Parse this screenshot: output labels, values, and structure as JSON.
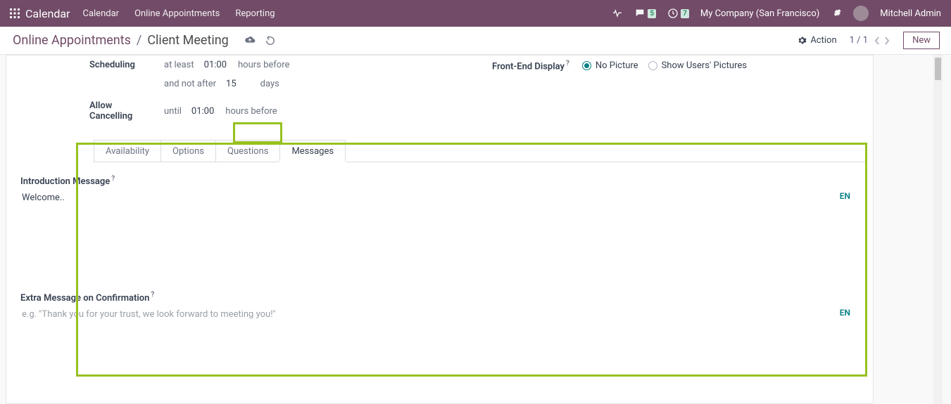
{
  "nav": {
    "brand": "Calendar",
    "menus": [
      "Calendar",
      "Online Appointments",
      "Reporting"
    ],
    "company": "My Company (San Francisco)",
    "user": "Mitchell Admin",
    "badge_chat": "5",
    "badge_clock": "7"
  },
  "cp": {
    "breadcrumb_parent": "Online Appointments",
    "breadcrumb_current": "Client Meeting",
    "action_label": "Action",
    "pager": "1 / 1",
    "new_label": "New"
  },
  "form": {
    "scheduling_label": "Scheduling",
    "at_least": "at least",
    "at_least_val": "01:00",
    "hours_before": "hours before",
    "and_not_after": "and not after",
    "not_after_val": "15",
    "days": "days",
    "allow_cancel_label": "Allow Cancelling",
    "until": "until",
    "until_val": "01:00",
    "front_end_label": "Front-End Display",
    "no_picture": "No Picture",
    "show_users": "Show Users' Pictures"
  },
  "tabs": {
    "t0": "Availability",
    "t1": "Options",
    "t2": "Questions",
    "t3": "Messages"
  },
  "messages": {
    "intro_label": "Introduction Message",
    "intro_value": "Welcome..",
    "confirm_label": "Extra Message on Confirmation",
    "confirm_placeholder": "e.g. \"Thank you for your trust, we look forward to meeting you!\"",
    "lang": "EN"
  }
}
